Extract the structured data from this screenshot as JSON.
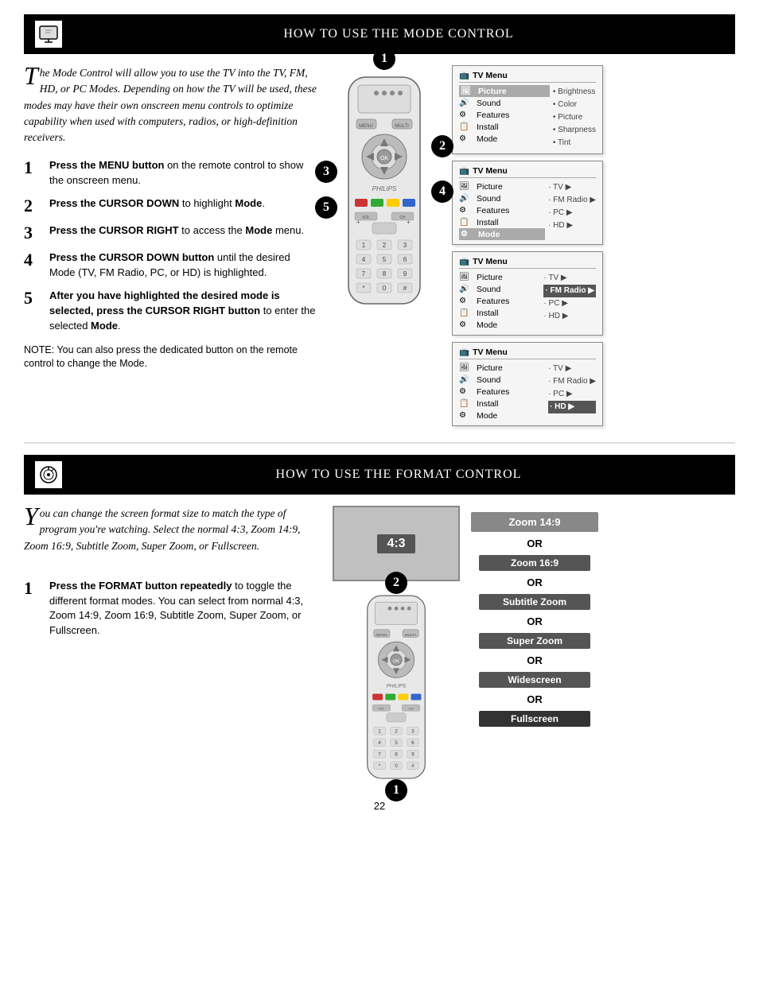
{
  "mode_section": {
    "header": {
      "title": "How to use the Mode Control"
    },
    "intro": "he Mode Control will allow you to use the TV into the TV, FM, HD, or PC Modes. Depending on how the TV will be used, these modes may have their own onscreen menu controls to optimize capability when used with computers, radios, or high-definition receivers.",
    "steps": [
      {
        "number": "1",
        "text": "Press the MENU button on the remote control to show the onscreen menu."
      },
      {
        "number": "2",
        "text": "Press the CURSOR DOWN to highlight Mode."
      },
      {
        "number": "3",
        "text": "Press the CURSOR RIGHT to access the Mode menu."
      },
      {
        "number": "4",
        "text": "Press the CURSOR DOWN button until the desired Mode (TV, FM Radio, PC, or HD) is highlighted."
      },
      {
        "number": "5",
        "text": "After you have highlighted the desired mode is selected, press the CURSOR RIGHT button to enter the selected Mode."
      }
    ],
    "note": "NOTE: You can also press the dedicated button on the remote control to change the Mode.",
    "menus": [
      {
        "title": "TV Menu",
        "rows": [
          {
            "label": "Picture",
            "icon": "🖼",
            "items": [
              "• Brightness",
              "• Color",
              "• Picture",
              "• Sharpness",
              "• Tint"
            ],
            "highlight": false,
            "arrow": false
          },
          {
            "label": "Sound",
            "icon": "🔊",
            "items": [],
            "highlight": false,
            "arrow": false
          },
          {
            "label": "Features",
            "icon": "⚙",
            "items": [],
            "highlight": false,
            "arrow": false
          },
          {
            "label": "Install",
            "icon": "📋",
            "items": [],
            "highlight": false,
            "arrow": false
          },
          {
            "label": "Mode",
            "icon": "⚙",
            "items": [],
            "highlight": false,
            "arrow": false
          }
        ]
      },
      {
        "title": "TV Menu",
        "rows": [
          {
            "label": "Picture",
            "icon": "🖼",
            "items": [
              "• TV ▶"
            ],
            "highlight": false,
            "arrow": true
          },
          {
            "label": "Sound",
            "icon": "🔊",
            "items": [
              "• FM Radio ▶"
            ],
            "highlight": false,
            "arrow": true
          },
          {
            "label": "Features",
            "icon": "⚙",
            "items": [
              "• PC ▶"
            ],
            "highlight": false,
            "arrow": true
          },
          {
            "label": "Install",
            "icon": "📋",
            "items": [
              "• HD ▶"
            ],
            "highlight": false,
            "arrow": true
          },
          {
            "label": "Mode",
            "icon": "⚙",
            "items": [],
            "highlight": true,
            "arrow": false
          }
        ]
      },
      {
        "title": "TV Menu",
        "rows": [
          {
            "label": "Picture",
            "icon": "🖼",
            "items": [
              "• TV ▶"
            ],
            "highlight": false,
            "arrow": true
          },
          {
            "label": "Sound",
            "icon": "🔊",
            "items": [
              "• FM Radio ▶"
            ],
            "highlight": true,
            "arrow": true
          },
          {
            "label": "Features",
            "icon": "⚙",
            "items": [
              "• PC ▶"
            ],
            "highlight": false,
            "arrow": true
          },
          {
            "label": "Install",
            "icon": "📋",
            "items": [
              "• HD ▶"
            ],
            "highlight": false,
            "arrow": true
          },
          {
            "label": "Mode",
            "icon": "⚙",
            "items": [],
            "highlight": false,
            "arrow": false
          }
        ]
      },
      {
        "title": "TV Menu",
        "rows": [
          {
            "label": "Picture",
            "icon": "🖼",
            "items": [
              "• TV ▶"
            ],
            "highlight": false,
            "arrow": true
          },
          {
            "label": "Sound",
            "icon": "🔊",
            "items": [
              "• FM Radio ▶"
            ],
            "highlight": false,
            "arrow": true
          },
          {
            "label": "Features",
            "icon": "⚙",
            "items": [
              "• PC ▶"
            ],
            "highlight": false,
            "arrow": true
          },
          {
            "label": "Install",
            "icon": "📋",
            "items": [
              "• HD ▶"
            ],
            "highlight": true,
            "arrow": true
          },
          {
            "label": "Mode",
            "icon": "⚙",
            "items": [],
            "highlight": false,
            "arrow": false
          }
        ]
      }
    ]
  },
  "format_section": {
    "header": {
      "title": "How to use the Format Control"
    },
    "intro": "ou can change the screen format size to match the type of program you're watching. Select the normal 4:3, Zoom 14:9, Zoom 16:9, Subtitle Zoom, Super Zoom, or Fullscreen.",
    "steps": [
      {
        "number": "1",
        "text": "Press the FORMAT button repeatedly to toggle the different format modes. You can select from normal 4:3, Zoom 14:9, Zoom 16:9, Subtitle Zoom, Super Zoom, or Fullscreen."
      }
    ],
    "screen_label": "4:3",
    "format_options": [
      {
        "label": "Zoom 14:9"
      },
      {
        "label": "Zoom 16:9"
      },
      {
        "label": "Subtitle Zoom"
      },
      {
        "label": "Super Zoom"
      },
      {
        "label": "Widescreen"
      },
      {
        "label": "Fullscreen"
      }
    ],
    "or_label": "OR"
  },
  "page_number": "22"
}
